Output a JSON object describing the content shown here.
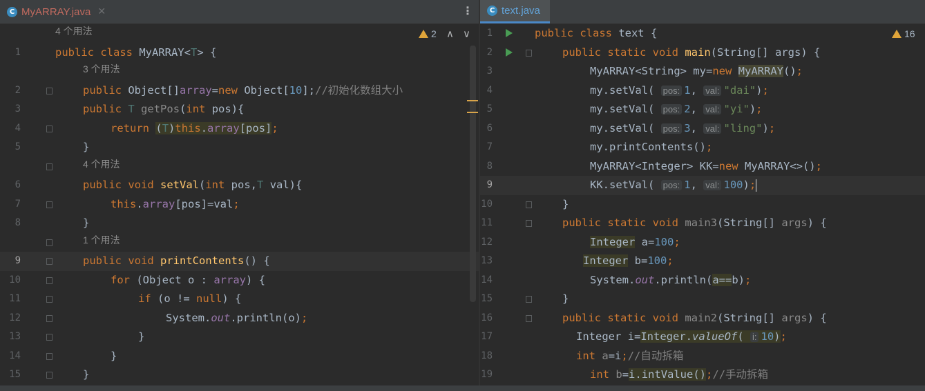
{
  "left": {
    "tab": {
      "name": "MyARRAY.java",
      "icon": "C",
      "close": "✕"
    },
    "more": "⋮",
    "warnings": "2",
    "nav_up": "∧",
    "nav_down": "∨",
    "lines": [
      {
        "hint": "4 个用法"
      },
      {
        "n": "1",
        "indent": 0,
        "html": "<span class='kw'>public class</span> MyARRAY&lt;<span class='tp'>T</span>&gt; {"
      },
      {
        "hint": "3 个用法",
        "indent": 1
      },
      {
        "n": "2",
        "indent": 1,
        "html": "<span class='kw'>public</span> Object[]<span class='fld'>array</span>=<span class='kw'>new</span> Object[<span class='num'>10</span>];<span class='cm'>//初始化数组大小</span>"
      },
      {
        "n": "3",
        "indent": 1,
        "html": "<span class='kw'>public</span> <span class='tp'>T</span> <span class='un'>getPos</span>(<span class='kw'>int</span> pos){"
      },
      {
        "n": "4",
        "indent": 2,
        "html": "<span class='kw'>return</span> <span class='hl'>(<span class='tp'>T</span>)<span class='kw'>this</span>.<span class='fld'>array</span>[pos]</span><span class='kw'>;</span>"
      },
      {
        "n": "5",
        "indent": 1,
        "html": "}"
      },
      {
        "hint": "4 个用法",
        "indent": 1
      },
      {
        "n": "6",
        "indent": 1,
        "html": "<span class='kw'>public void</span> <span class='fn'>setVal</span>(<span class='kw'>int</span> pos,<span class='tp'>T</span> val){"
      },
      {
        "n": "7",
        "indent": 2,
        "html": "<span class='kw'>this</span>.<span class='fld'>array</span>[pos]=val<span class='kw'>;</span>"
      },
      {
        "n": "8",
        "indent": 1,
        "html": "}"
      },
      {
        "hint": "1 个用法",
        "indent": 1
      },
      {
        "n": "9",
        "indent": 1,
        "current": true,
        "html": "<span class='kw'>public void</span> <span class='fn'>printContents</span>() {"
      },
      {
        "n": "10",
        "indent": 2,
        "html": "<span class='kw'>for</span> (Object o : <span class='fld'>array</span>) {"
      },
      {
        "n": "11",
        "indent": 3,
        "html": "<span class='kw'>if</span> (o != <span class='kw'>null</span>) {"
      },
      {
        "n": "12",
        "indent": 4,
        "html": "System.<span class='st'>out</span>.println(o)<span class='kw'>;</span>"
      },
      {
        "n": "13",
        "indent": 3,
        "html": "}"
      },
      {
        "n": "14",
        "indent": 2,
        "html": "}"
      },
      {
        "n": "15",
        "indent": 1,
        "html": "}"
      }
    ]
  },
  "right": {
    "tab": {
      "name": "text.java",
      "icon": "C"
    },
    "warnings": "16",
    "lines": [
      {
        "n": "1",
        "indent": 0,
        "run": true,
        "html": "<span class='kw'>public class</span> text {"
      },
      {
        "n": "2",
        "indent": 1,
        "run": true,
        "html": "<span class='kw'>public static void</span> <span class='fn'>main</span>(String[] args) {"
      },
      {
        "n": "3",
        "indent": 2,
        "html": "MyARRAY&lt;String&gt; my=<span class='kw'>new</span> <span class='hl2'>MyARRAY</span>()<span class='kw'>;</span>"
      },
      {
        "n": "4",
        "indent": 2,
        "html": "my.setVal( <span class='ih'>pos:</span><span class='num'>1</span>, <span class='ih'>val:</span><span class='str'>\"dai\"</span>)<span class='kw'>;</span>"
      },
      {
        "n": "5",
        "indent": 2,
        "html": "my.setVal( <span class='ih'>pos:</span><span class='num'>2</span>, <span class='ih'>val:</span><span class='str'>\"yi\"</span>)<span class='kw'>;</span>"
      },
      {
        "n": "6",
        "indent": 2,
        "html": "my.setVal( <span class='ih'>pos:</span><span class='num'>3</span>, <span class='ih'>val:</span><span class='str'>\"ling\"</span>)<span class='kw'>;</span>"
      },
      {
        "n": "7",
        "indent": 2,
        "html": "my.printContents()<span class='kw'>;</span>"
      },
      {
        "n": "8",
        "indent": 2,
        "html": "MyARRAY&lt;Integer&gt; KK=<span class='kw'>new</span> MyARRAY&lt;&gt;()<span class='kw'>;</span>"
      },
      {
        "n": "9",
        "indent": 2,
        "current": true,
        "html": "KK.setVal( <span class='ih'>pos:</span><span class='num'>1</span>, <span class='ih'>val:</span><span class='num'>100</span>)<span class='kw'>;</span><span class='caret'></span>"
      },
      {
        "n": "10",
        "indent": 1,
        "html": "}"
      },
      {
        "n": "11",
        "indent": 1,
        "html": "<span class='kw'>public static void</span> <span class='un'>main3</span>(String[] <span class='un'>args</span>) {"
      },
      {
        "n": "12",
        "indent": 2,
        "html": "<span class='hl'>Integer</span> a=<span class='num'>100</span><span class='kw'>;</span>"
      },
      {
        "n": "13",
        "indent": 1.75,
        "html": "<span class='hl'>Integer</span> b=<span class='num'>100</span><span class='kw'>;</span>"
      },
      {
        "n": "14",
        "indent": 2,
        "html": "System.<span class='st'>out</span>.println(<span class='hl'>a==</span>b)<span class='kw'>;</span>"
      },
      {
        "n": "15",
        "indent": 1,
        "html": "}"
      },
      {
        "n": "16",
        "indent": 1,
        "html": "<span class='kw'>public static void</span> <span class='un'>main2</span>(String[] <span class='un'>args</span>) {"
      },
      {
        "n": "17",
        "indent": 1.5,
        "html": "Integer i=<span class='hl'>Integer.<i>valueOf</i>( <span class='ih'>i:</span><span class='num'>10</span>)</span><span class='kw'>;</span>"
      },
      {
        "n": "18",
        "indent": 1.5,
        "html": "<span class='kw'>int</span> <span class='un'>a</span>=i<span class='kw'>;</span><span class='cm'>//自动拆箱</span>"
      },
      {
        "n": "19",
        "indent": 2,
        "html": "<span class='kw'>int</span> <span class='un'>b</span>=<span class='hl'>i.intValue()</span><span class='kw'>;</span><span class='cm'>//手动拆箱</span>"
      }
    ]
  }
}
